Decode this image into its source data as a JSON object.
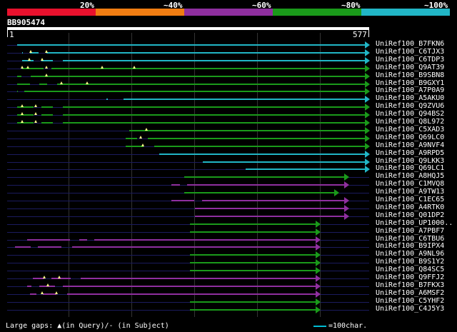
{
  "legend": {
    "segments": [
      "#e8112d",
      "#f07d12",
      "#8f2f9f",
      "#1a9a1a",
      "#21b6c6"
    ],
    "labels": [
      "20%",
      "~40%",
      "~60%",
      "~80%",
      "~100%"
    ]
  },
  "query": {
    "id": "BB905474",
    "start": "1",
    "end": "577"
  },
  "colors": {
    "line_bg": "#1b1b5e",
    "gap": "#ffff88"
  },
  "rows": [
    {
      "label": "UniRef100_B7FKN6",
      "color": "#21b6c6",
      "start": 17,
      "end": 577,
      "gaps": [],
      "qgaps": []
    },
    {
      "label": "UniRef100_C6TJX3",
      "color": "#21b6c6",
      "start": 25,
      "end": 577,
      "gaps": [
        [
          27,
          37
        ],
        [
          58,
          64
        ]
      ],
      "qgaps": [
        39,
        64
      ]
    },
    {
      "label": "UniRef100_C6TDP3",
      "color": "#21b6c6",
      "start": 25,
      "end": 577,
      "gaps": [
        [
          50,
          56
        ],
        [
          80,
          90
        ]
      ],
      "qgaps": [
        36,
        57
      ]
    },
    {
      "label": "UniRef100_Q9AT39",
      "color": "#1a9a1a",
      "start": 25,
      "end": 577,
      "gaps": [
        [
          66,
          72
        ]
      ],
      "qgaps": [
        25,
        34,
        64,
        152,
        203
      ]
    },
    {
      "label": "UniRef100_B9SBN8",
      "color": "#1a9a1a",
      "start": 17,
      "end": 577,
      "gaps": [
        [
          31,
          38
        ]
      ],
      "qgaps": [
        63
      ]
    },
    {
      "label": "UniRef100_B9GXY1",
      "color": "#1a9a1a",
      "start": 17,
      "end": 577,
      "gaps": [
        [
          44,
          52
        ],
        [
          72,
          80
        ]
      ],
      "qgaps": [
        87,
        128
      ]
    },
    {
      "label": "UniRef100_A7P0A9",
      "color": "#1a9a1a",
      "start": 17,
      "end": 577,
      "gaps": [
        [
          20,
          28
        ]
      ],
      "qgaps": []
    },
    {
      "label": "UniRef100_A5AKU0",
      "color": "#21b6c6",
      "start": 159,
      "end": 577,
      "gaps": [
        [
          168,
          186
        ]
      ],
      "qgaps": []
    },
    {
      "label": "UniRef100_Q9ZVU6",
      "color": "#1a9a1a",
      "start": 17,
      "end": 577,
      "gaps": [
        [
          50,
          56
        ],
        [
          80,
          90
        ]
      ],
      "qgaps": [
        25,
        46
      ]
    },
    {
      "label": "UniRef100_Q94BS2",
      "color": "#1a9a1a",
      "start": 17,
      "end": 577,
      "gaps": [
        [
          50,
          56
        ],
        [
          80,
          90
        ]
      ],
      "qgaps": [
        25,
        46
      ]
    },
    {
      "label": "UniRef100_Q8L972",
      "color": "#1a9a1a",
      "start": 17,
      "end": 577,
      "gaps": [
        [
          50,
          56
        ],
        [
          80,
          90
        ]
      ],
      "qgaps": [
        25,
        46
      ]
    },
    {
      "label": "UniRef100_C5XAD3",
      "color": "#1a9a1a",
      "start": 195,
      "end": 577,
      "gaps": [],
      "qgaps": [
        222
      ]
    },
    {
      "label": "UniRef100_Q69LC0",
      "color": "#1a9a1a",
      "start": 190,
      "end": 577,
      "gaps": [
        [
          215,
          225
        ]
      ],
      "qgaps": [
        214
      ]
    },
    {
      "label": "UniRef100_A9NVF4",
      "color": "#1a9a1a",
      "start": 190,
      "end": 577,
      "gaps": [
        [
          225,
          235
        ]
      ],
      "qgaps": [
        217
      ]
    },
    {
      "label": "UniRef100_A9RPD5",
      "color": "#21b6c6",
      "start": 243,
      "end": 577,
      "gaps": [],
      "qgaps": []
    },
    {
      "label": "UniRef100_Q9LKK3",
      "color": "#21b6c6",
      "start": 312,
      "end": 577,
      "gaps": [],
      "qgaps": []
    },
    {
      "label": "UniRef100_Q69LC1",
      "color": "#21b6c6",
      "start": 381,
      "end": 577,
      "gaps": [],
      "qgaps": []
    },
    {
      "label": "UniRef100_A8HQJ5",
      "color": "#1a9a1a",
      "start": 283,
      "end": 544,
      "gaps": [],
      "qgaps": []
    },
    {
      "label": "UniRef100_C1MVQ8",
      "color": "#8f2f9f",
      "start": 262,
      "end": 544,
      "gaps": [
        [
          283,
          287
        ]
      ],
      "qgaps": []
    },
    {
      "label": "UniRef100_A9TW13",
      "color": "#1a9a1a",
      "start": 283,
      "end": 528,
      "gaps": [],
      "qgaps": []
    },
    {
      "label": "UniRef100_C1EC65",
      "color": "#8f2f9f",
      "start": 262,
      "end": 544,
      "gaps": [
        [
          305,
          311
        ]
      ],
      "qgaps": []
    },
    {
      "label": "UniRef100_A4RTK0",
      "color": "#8f2f9f",
      "start": 300,
      "end": 544,
      "gaps": [],
      "qgaps": []
    },
    {
      "label": "UniRef100_Q01DP2",
      "color": "#8f2f9f",
      "start": 300,
      "end": 544,
      "gaps": [],
      "qgaps": []
    },
    {
      "label": "UniRef100_UP1000..",
      "color": "#1a9a1a",
      "start": 292,
      "end": 499,
      "gaps": [],
      "qgaps": []
    },
    {
      "label": "UniRef100_A7PBF7",
      "color": "#1a9a1a",
      "start": 292,
      "end": 499,
      "gaps": [],
      "qgaps": []
    },
    {
      "label": "UniRef100_C6TBU6",
      "color": "#8f2f9f",
      "start": 33,
      "end": 499,
      "gaps": [
        [
          108,
          116
        ],
        [
          135,
          140
        ]
      ],
      "qgaps": []
    },
    {
      "label": "UniRef100_B9IPX4",
      "color": "#8f2f9f",
      "start": 13,
      "end": 499,
      "gaps": [
        [
          45,
          50
        ],
        [
          94,
          104
        ]
      ],
      "qgaps": []
    },
    {
      "label": "UniRef100_A9NL96",
      "color": "#1a9a1a",
      "start": 292,
      "end": 499,
      "gaps": [],
      "qgaps": []
    },
    {
      "label": "UniRef100_B9S1Y2",
      "color": "#1a9a1a",
      "start": 292,
      "end": 499,
      "gaps": [],
      "qgaps": []
    },
    {
      "label": "UniRef100_Q84SC5",
      "color": "#1a9a1a",
      "start": 292,
      "end": 499,
      "gaps": [],
      "qgaps": []
    },
    {
      "label": "UniRef100_Q9FFJ2",
      "color": "#8f2f9f",
      "start": 42,
      "end": 499,
      "gaps": [
        [
          67,
          72
        ],
        [
          109,
          118
        ]
      ],
      "qgaps": [
        60,
        84
      ]
    },
    {
      "label": "UniRef100_B7FKX3",
      "color": "#8f2f9f",
      "start": 33,
      "end": 499,
      "gaps": [
        [
          47,
          52
        ],
        [
          84,
          90
        ]
      ],
      "qgaps": [
        66
      ]
    },
    {
      "label": "UniRef100_A6MSF2",
      "color": "#8f2f9f",
      "start": 37,
      "end": 499,
      "gaps": [
        [
          54,
          58
        ],
        [
          86,
          96
        ]
      ],
      "qgaps": [
        57,
        79
      ]
    },
    {
      "label": "UniRef100_C5YHF2",
      "color": "#1a9a1a",
      "start": 292,
      "end": 499,
      "gaps": [],
      "qgaps": []
    },
    {
      "label": "UniRef100_C4J5Y3",
      "color": "#1a9a1a",
      "start": 292,
      "end": 499,
      "gaps": [],
      "qgaps": []
    }
  ],
  "footer": {
    "large_gaps": "Large gaps: ▲(in Query)/- (in Subject)",
    "scale": "=100char."
  }
}
